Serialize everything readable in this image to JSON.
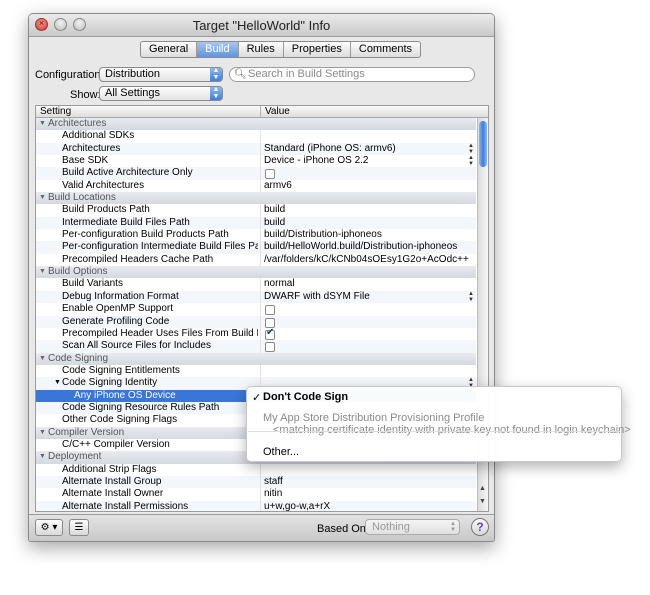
{
  "window": {
    "title": "Target \"HelloWorld\" Info",
    "tabs": [
      {
        "label": "General",
        "selected": false
      },
      {
        "label": "Build",
        "selected": true
      },
      {
        "label": "Rules",
        "selected": false
      },
      {
        "label": "Properties",
        "selected": false
      },
      {
        "label": "Comments",
        "selected": false
      }
    ]
  },
  "toolbar": {
    "configuration_label": "Configuration:",
    "configuration_value": "Distribution",
    "show_label": "Show:",
    "show_value": "All Settings",
    "search_placeholder": "Search in Build Settings"
  },
  "table": {
    "col_setting": "Setting",
    "col_value": "Value",
    "rows": [
      {
        "type": "group",
        "name": "Architectures"
      },
      {
        "name": "Additional SDKs",
        "value": ""
      },
      {
        "name": "Architectures",
        "value": "Standard (iPhone OS: armv6)",
        "stepper": true
      },
      {
        "name": "Base SDK",
        "value": "Device - iPhone OS 2.2",
        "stepper": true
      },
      {
        "name": "Build Active Architecture Only",
        "checkbox": false
      },
      {
        "name": "Valid Architectures",
        "value": "armv6"
      },
      {
        "type": "group",
        "name": "Build Locations"
      },
      {
        "name": "Build Products Path",
        "value": "build"
      },
      {
        "name": "Intermediate Build Files Path",
        "value": "build"
      },
      {
        "name": "Per-configuration Build Products Path",
        "value": "build/Distribution-iphoneos"
      },
      {
        "name": "Per-configuration Intermediate Build Files Path",
        "value": "build/HelloWorld.build/Distribution-iphoneos"
      },
      {
        "name": "Precompiled Headers Cache Path",
        "value": "/var/folders/kC/kCNb04sOEsy1G2o+AcOdc++..."
      },
      {
        "type": "group",
        "name": "Build Options"
      },
      {
        "name": "Build Variants",
        "value": "normal"
      },
      {
        "name": "Debug Information Format",
        "value": "DWARF with dSYM File",
        "stepper": true
      },
      {
        "name": "Enable OpenMP Support",
        "checkbox": false
      },
      {
        "name": "Generate Profiling Code",
        "checkbox": false
      },
      {
        "name": "Precompiled Header Uses Files From Build Di...",
        "checkbox": true
      },
      {
        "name": "Scan All Source Files for Includes",
        "checkbox": false
      },
      {
        "type": "group",
        "name": "Code Signing"
      },
      {
        "name": "Code Signing Entitlements",
        "value": ""
      },
      {
        "name": "Code Signing Identity",
        "value": "",
        "stepper": true,
        "expanded": true
      },
      {
        "name": "Any iPhone OS Device",
        "value": "",
        "selected": true,
        "indent": true
      },
      {
        "name": "Code Signing Resource Rules Path",
        "value": ""
      },
      {
        "name": "Other Code Signing Flags",
        "value": ""
      },
      {
        "type": "group",
        "name": "Compiler Version"
      },
      {
        "name": "C/C++ Compiler Version",
        "value": ""
      },
      {
        "type": "group",
        "name": "Deployment"
      },
      {
        "name": "Additional Strip Flags",
        "value": ""
      },
      {
        "name": "Alternate Install Group",
        "value": "staff"
      },
      {
        "name": "Alternate Install Owner",
        "value": "nitin"
      },
      {
        "name": "Alternate Install Permissions",
        "value": "u+w,go-w,a+rX"
      }
    ]
  },
  "footer": {
    "based_on_label": "Based On:",
    "based_on_value": "Nothing",
    "help_label": "?"
  },
  "popup_menu": {
    "item_dont_sign": "Don't Code Sign",
    "checkmark": "✓",
    "item_profile": "My App Store Distribution Provisioning Profile",
    "item_profile_note": "<matching certificate identity with private key not found in login keychain>",
    "item_other": "Other..."
  },
  "colors": {
    "selection": "#3876d8",
    "accent": "#5f95de"
  }
}
